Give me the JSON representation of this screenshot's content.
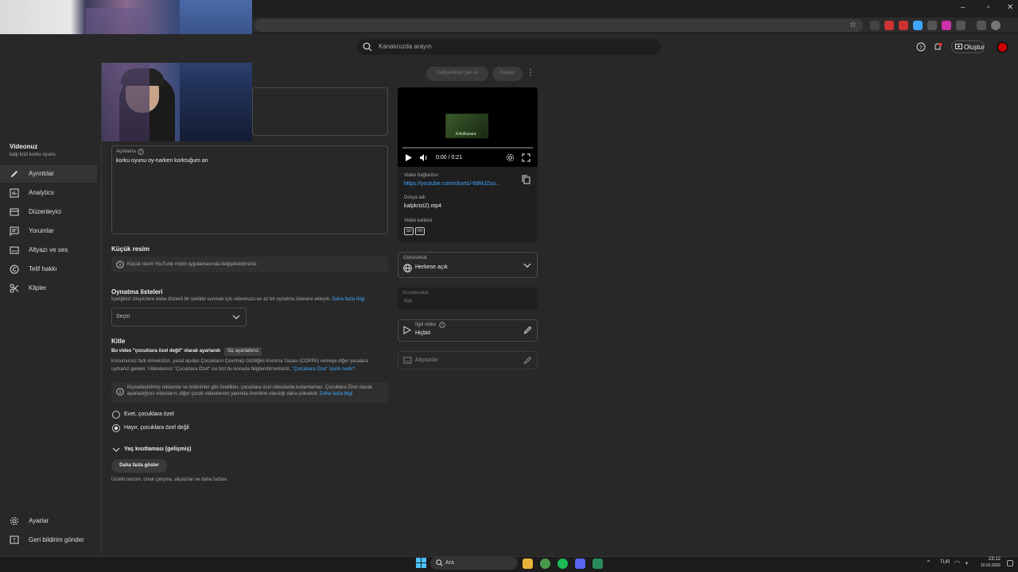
{
  "browser": {
    "minimize": "–",
    "maximize": "▫",
    "close": "✕"
  },
  "header": {
    "search_placeholder": "Kanalınızda arayın",
    "create_label": "Oluştur"
  },
  "sidebar": {
    "title": "Videonuz",
    "subtitle": "kalp krizi korku oyunu",
    "items": [
      {
        "label": "Ayrıntılar",
        "icon": "pencil-icon"
      },
      {
        "label": "Analytics",
        "icon": "analytics-icon"
      },
      {
        "label": "Düzenleyici",
        "icon": "editor-icon"
      },
      {
        "label": "Yorumlar",
        "icon": "comments-icon"
      },
      {
        "label": "Altyazı ve ses",
        "icon": "subtitles-icon"
      },
      {
        "label": "Telif hakkı",
        "icon": "copyright-icon"
      },
      {
        "label": "Klipler",
        "icon": "scissors-icon"
      }
    ],
    "settings": "Ayarlar",
    "feedback": "Geri bildirim gönder"
  },
  "toolbar": {
    "undo": "Değişiklikleri geri al",
    "save": "Kaydet"
  },
  "description": {
    "label": "Açıklama",
    "value": "korku oyunu oy-narken korktuğum an"
  },
  "thumbnail": {
    "title": "Küçük resim",
    "info": "Küçük resmi YouTube mobil uygulamasında değiştirebilirsiniz."
  },
  "playlists": {
    "title": "Oynatma listeleri",
    "desc": "İçeriğinizi izleyicilere daha düzenli bir şekilde sunmak için videonuzu en az bir oynatma listesine ekleyin.",
    "link": "Daha fazla bilgi",
    "select": "Seçin"
  },
  "audience": {
    "title": "Kitle",
    "status": "Bu video \"çocuklara özel değil\" olarak ayarlandı",
    "badge": "Siz ayarladınız",
    "desc1": "Konumunuz fark etmeksizin, yasal açıdan Çocukların Çevrimiçi Gizliliğini Koruma Yasası (COPPA) ve/veya diğer yasalara",
    "desc2": "uymanız gerekir. Videolarınız \"Çocuklara Özel\" ise bizi bu konuda bilgilendirmelisiniz.",
    "desc_link": "\"Çocuklara Özel\" içerik nedir?",
    "info1": "Kişiselleştirilmiş reklamlar ve bildirimler gibi özellikler, çocuklara özel videolarda kullanılamaz. Çocuklara Özel olarak",
    "info2": "ayarladığınız videoların, diğer çocuk videolarının yanında önerilme olasılığı daha yüksektir.",
    "info_link": "Daha fazla bilgi",
    "yes": "Evet, çocuklara özel",
    "no": "Hayır, çocuklara özel değil",
    "selected": "no",
    "age": "Yaş kısıtlaması (gelişmiş)",
    "more_btn": "Daha fazla göster",
    "more_desc": "Ücretli tanıtım, ortak çalışma, altyazılar ve daha fazlası"
  },
  "video": {
    "time": "0:00 / 0:21",
    "progress": 0.0,
    "link_label": "Video bağlantısı",
    "link": "https://youtube.com/shorts/-68MJZso...",
    "file_label": "Dosya adı",
    "file": "kalpkrizi2).mp4",
    "quality_label": "Video kalitesi",
    "quality": [
      "SD",
      "HD"
    ],
    "thumb_text": "KrikiKazara"
  },
  "visibility": {
    "label": "Görünürlük",
    "value": "Herkese açık"
  },
  "restrictions": {
    "label": "Kısıtlamalar",
    "value": "Yok"
  },
  "related": {
    "label": "İlgili video",
    "value": "Hiçbiri"
  },
  "subtitles": {
    "label": "Altyazılar"
  },
  "taskbar": {
    "search": "Ara",
    "lang": "TUR",
    "time": "23:12",
    "date": "10.03.2026"
  },
  "colors": {
    "accent": "#3ea6ff",
    "brand_red": "#cc0000",
    "bg": "#282828"
  }
}
